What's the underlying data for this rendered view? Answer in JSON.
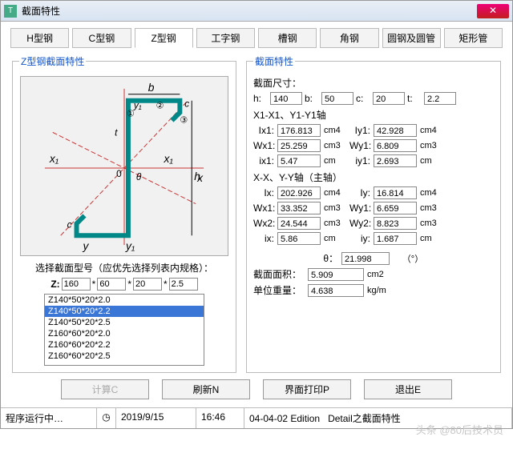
{
  "window": {
    "title": "截面特性",
    "close": "✕",
    "app_icon": "T"
  },
  "tabs": [
    "H型钢",
    "C型钢",
    "Z型钢",
    "工字钢",
    "槽钢",
    "角钢",
    "圆钢及圆管",
    "矩形管"
  ],
  "active_tab": 2,
  "left": {
    "legend": "Z型钢截面特性",
    "diagram_labels": {
      "b": "b",
      "y1": "y₁",
      "t": "t",
      "x1": "x₁",
      "x": "x",
      "y": "y",
      "h": "h",
      "c": "c",
      "O": "0",
      "theta": "θ",
      "n1": "①",
      "n2": "②",
      "n3": "③"
    },
    "select_label": "选择截面型号（应优先选择列表内规格）：",
    "z_prefix": "Z:",
    "z_vals": [
      "160",
      "60",
      "20",
      "2.5"
    ],
    "z_sep": "*",
    "list": [
      "Z140*50*20*2.0",
      "Z140*50*20*2.2",
      "Z140*50*20*2.5",
      "Z160*60*20*2.0",
      "Z160*60*20*2.2",
      "Z160*60*20*2.5"
    ],
    "list_selected": 1
  },
  "right": {
    "legend": "截面特性",
    "dim_title": "截面尺寸：",
    "dims": {
      "h_lab": "h:",
      "h": "140",
      "b_lab": "b:",
      "b": "50",
      "c_lab": "c:",
      "c": "20",
      "t_lab": "t:",
      "t": "2.2"
    },
    "axis1_title": "X1-X1、Y1-Y1轴",
    "axis1": {
      "Ix1_lab": "Ix1:",
      "Ix1": "176.813",
      "Ix1_u": "cm4",
      "Iy1_lab": "Iy1:",
      "Iy1": "42.928",
      "Iy1_u": "cm4",
      "Wx1_lab": "Wx1:",
      "Wx1": "25.259",
      "Wx1_u": "cm3",
      "Wy1_lab": "Wy1:",
      "Wy1": "6.809",
      "Wy1_u": "cm3",
      "ix1_lab": "ix1:",
      "ix1": "5.47",
      "ix1_u": "cm",
      "iy1_lab": "iy1:",
      "iy1": "2.693",
      "iy1_u": "cm"
    },
    "axis2_title": "X-X、Y-Y轴（主轴）",
    "axis2": {
      "Ix_lab": "Ix:",
      "Ix": "202.926",
      "Ix_u": "cm4",
      "Iy_lab": "Iy:",
      "Iy": "16.814",
      "Iy_u": "cm4",
      "Wx1_lab": "Wx1:",
      "Wx1": "33.352",
      "Wx1_u": "cm3",
      "Wy1_lab": "Wy1:",
      "Wy1": "6.659",
      "Wy1_u": "cm3",
      "Wx2_lab": "Wx2:",
      "Wx2": "24.544",
      "Wx2_u": "cm3",
      "Wy2_lab": "Wy2:",
      "Wy2": "8.823",
      "Wy2_u": "cm3",
      "ix_lab": "ix:",
      "ix": "5.86",
      "ix_u": "cm",
      "iy_lab": "iy:",
      "iy": "1.687",
      "iy_u": "cm"
    },
    "theta_lab": "θ：",
    "theta": "21.998",
    "theta_u": "（°）",
    "area_lab": "截面面积：",
    "area": "5.909",
    "area_u": "cm2",
    "weight_lab": "单位重量：",
    "weight": "4.638",
    "weight_u": "kg/m"
  },
  "buttons": {
    "calc": "计算C",
    "refresh": "刷新N",
    "print": "界面打印P",
    "exit": "退出E"
  },
  "status": {
    "running": "程序运行中…",
    "date": "2019/9/15",
    "time": "16:46",
    "edition": "04-04-02 Edition",
    "detail": "Detail之截面特性",
    "clock_icon": "◷"
  },
  "watermark": "头条 @80后技术员"
}
